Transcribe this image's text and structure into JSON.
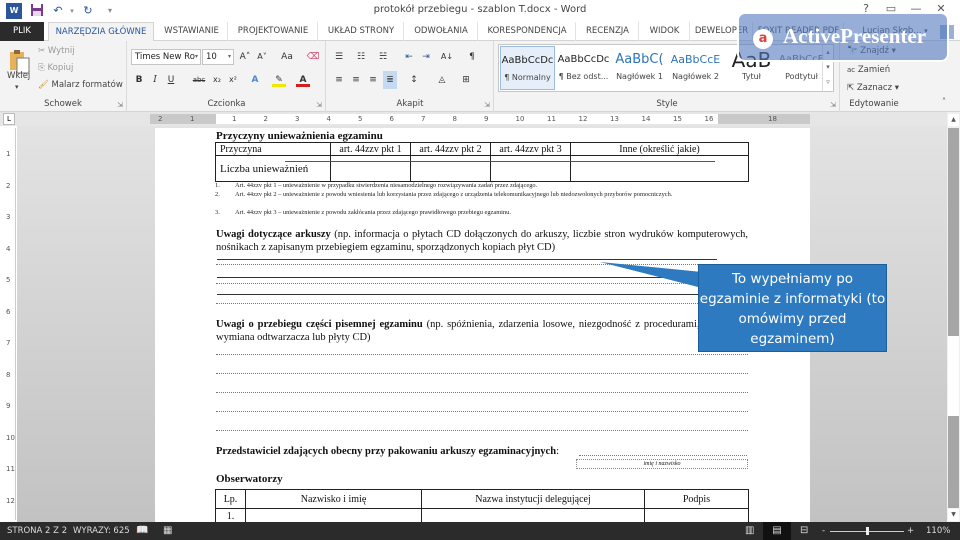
{
  "window": {
    "title": "protokół przebiegu - szablon T.docx - Word",
    "app_icon": "W",
    "help_label": "?",
    "restore_label": "▭",
    "minimize_label": "—",
    "close_label": "✕"
  },
  "quick_access": {
    "save_icon": "💾",
    "undo_icon": "↶",
    "redo_icon": "↻",
    "customize_icon": "▾"
  },
  "tabs": [
    {
      "label": "PLIK"
    },
    {
      "label": "NARZĘDZIA GŁÓWNE"
    },
    {
      "label": "WSTAWIANIE"
    },
    {
      "label": "PROJEKTOWANIE"
    },
    {
      "label": "UKŁAD STRONY"
    },
    {
      "label": "ODWOŁANIA"
    },
    {
      "label": "KORESPONDENCJA"
    },
    {
      "label": "RECENZJA"
    },
    {
      "label": "WIDOK"
    },
    {
      "label": "DEWELOPER"
    },
    {
      "label": "FOXIT READER PDF"
    }
  ],
  "user": {
    "name": "Lucjan Skob...",
    "caret": "▾"
  },
  "ribbon": {
    "clipboard": {
      "label": "Schowek",
      "paste": "Wklej",
      "cut": "Wytnij",
      "copy": "Kopiuj",
      "format_painter": "Malarz formatów"
    },
    "font": {
      "label": "Czcionka",
      "font_name": "Times New Ro",
      "font_size": "10",
      "grow": "A˄",
      "shrink": "A˅",
      "case": "Aa",
      "bold": "B",
      "italic": "I",
      "underline": "U",
      "strike": "abc",
      "subscript": "x₂",
      "superscript": "x²"
    },
    "paragraph": {
      "label": "Akapit",
      "pilcrow": "¶"
    },
    "styles": {
      "label": "Style",
      "items": [
        {
          "preview": "AaBbCcDc",
          "name": "¶ Normalny"
        },
        {
          "preview": "AaBbCcDc",
          "name": "¶ Bez odst..."
        },
        {
          "preview": "AaBbC(",
          "name": "Nagłówek 1"
        },
        {
          "preview": "AaBbCcE",
          "name": "Nagłówek 2"
        },
        {
          "preview": "AaB",
          "name": "Tytuł"
        },
        {
          "preview": "AaBbCcE",
          "name": "Podtytuł"
        }
      ]
    },
    "editing": {
      "label": "Edytowanie",
      "find": "Znajdź",
      "replace": "Zamień",
      "select": "Zaznacz"
    }
  },
  "ruler": {
    "h_numbers": [
      "2",
      "1",
      "1",
      "2",
      "3",
      "4",
      "5",
      "6",
      "7",
      "8",
      "9",
      "10",
      "11",
      "12",
      "13",
      "14",
      "15",
      "16",
      "18"
    ],
    "v_numbers": [
      "1",
      "2",
      "3",
      "4",
      "5",
      "6",
      "7",
      "8",
      "9",
      "10",
      "11",
      "12"
    ]
  },
  "document": {
    "heading1": "Przyczyny unieważnienia egzaminu",
    "table1": {
      "header": [
        "Przyczyna",
        "art. 44zzv pkt 1",
        "art. 44zzv pkt 2",
        "art. 44zzv pkt 3",
        "Inne (określić jakie)"
      ],
      "row": [
        "Liczba unieważnień",
        "",
        "",
        "",
        ""
      ]
    },
    "footnotes": [
      {
        "n": "1.",
        "text": "Art. 44zzv pkt 1 – unieważnienie w przypadku stwierdzenia niesamodzielnego rozwiązywania zadań przez zdającego."
      },
      {
        "n": "2.",
        "text": "Art. 44zzv pkt 2 – unieważnienie z powodu wniesienia lub korzystania przez zdającego z urządzenia telekomunikacyjnego lub niedozwolonych przyborów pomocniczych."
      },
      {
        "n": "3.",
        "text": "Art. 44zzv pkt 3 – unieważnienie z powodu zakłócania przez zdającego prawidłowego przebiegu egzaminu."
      }
    ],
    "remarks_sheets": {
      "bold": "Uwagi dotyczące arkuszy",
      "text": " (np. informacja o płytach CD dołączonych do arkuszy, liczbie stron wydruków komputerowych, nośnikach z zapisanym przebiegiem egzaminu, sporządzonych kopiach płyt CD)"
    },
    "remarks_written": {
      "bold": "Uwagi o przebiegu części pisemnej egzaminu",
      "text": " (np. spóźnienia, zdarzenia losowe, niezgodność z procedurami, zdających, wymiana odtwarzacza lub płyty CD)"
    },
    "representative": {
      "label": "Przedstawiciel zdających obecny przy pakowaniu arkuszy egzaminacyjnych",
      "colon": ":",
      "hint": "imię i nazwisko"
    },
    "observers": {
      "heading": "Obserwatorzy",
      "header": [
        "Lp.",
        "Nazwisko i imię",
        "Nazwa instytucji delegującej",
        "Podpis"
      ],
      "rows": [
        [
          "1.",
          "",
          "",
          ""
        ]
      ]
    }
  },
  "callout": {
    "text": "To wypełniamy po egzaminie z informatyki (to omówimy przed egzaminem)",
    "color": "#2e7ac0"
  },
  "watermark": {
    "text": "ActivePresenter",
    "logo": "a"
  },
  "status": {
    "page": "STRONA 2 Z 2",
    "words": "WYRAZY: 625",
    "zoom": "110%",
    "zoom_minus": "-",
    "zoom_plus": "+"
  }
}
